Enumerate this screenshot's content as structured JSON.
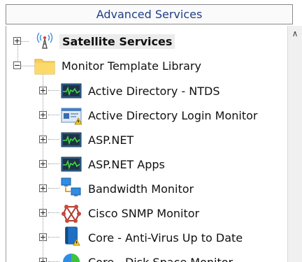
{
  "panel": {
    "title": "Advanced Services"
  },
  "tree": {
    "root": {
      "label": "Satellite Services",
      "icon": "satellite-antenna-icon"
    },
    "library": {
      "label": "Monitor Template Library",
      "icon": "folder-icon",
      "items": [
        {
          "label": "Active Directory - NTDS",
          "icon": "performance-monitor-icon"
        },
        {
          "label": "Active Directory Login Monitor",
          "icon": "login-monitor-warning-icon"
        },
        {
          "label": "ASP.NET",
          "icon": "performance-monitor-icon"
        },
        {
          "label": "ASP.NET Apps",
          "icon": "performance-monitor-icon"
        },
        {
          "label": "Bandwidth Monitor",
          "icon": "network-computers-icon"
        },
        {
          "label": "Cisco SNMP Monitor",
          "icon": "snmp-network-icon"
        },
        {
          "label": "Core - Anti-Virus Up to Date",
          "icon": "antivirus-book-warning-icon"
        },
        {
          "label": "Core - Disk Space Monitor",
          "icon": "disk-pie-icon"
        }
      ]
    }
  },
  "colors": {
    "header_text": "#1f3f86",
    "selected_bg": "#ececec"
  }
}
